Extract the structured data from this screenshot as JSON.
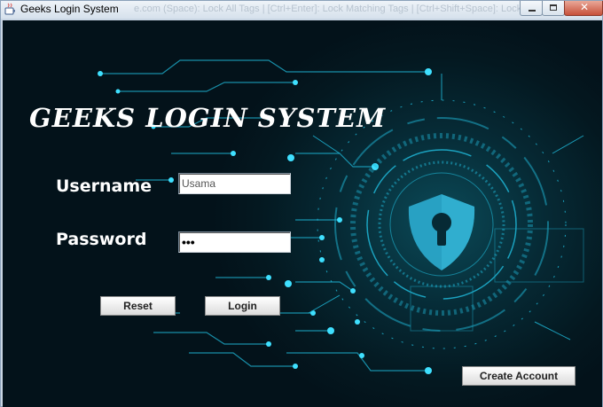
{
  "window": {
    "title": "Geeks Login System",
    "background_title_text": "e.com (Space): Lock All Tags | [Ctrl+Enter]: Lock Matching Tags | [Ctrl+Shift+Space]: Lock",
    "controls": {
      "minimize_icon": "minimize-icon",
      "maximize_icon": "maximize-icon",
      "close_icon": "close-icon",
      "close_glyph": "✕"
    }
  },
  "login_form": {
    "heading": "GEEKS LOGIN SYSTEM",
    "username_label": "Username",
    "username_value": "Usama",
    "password_label": "Password",
    "password_value": "•••",
    "reset_label": "Reset",
    "login_label": "Login",
    "create_account_label": "Create Account"
  },
  "theme": {
    "background": "#041820",
    "circuit_color": "#1fb6d6",
    "shield_color": "#2aa7c9",
    "text_color": "#ffffff"
  },
  "icons": {
    "app": "java-cup-icon",
    "security": "shield-keyhole-icon"
  }
}
